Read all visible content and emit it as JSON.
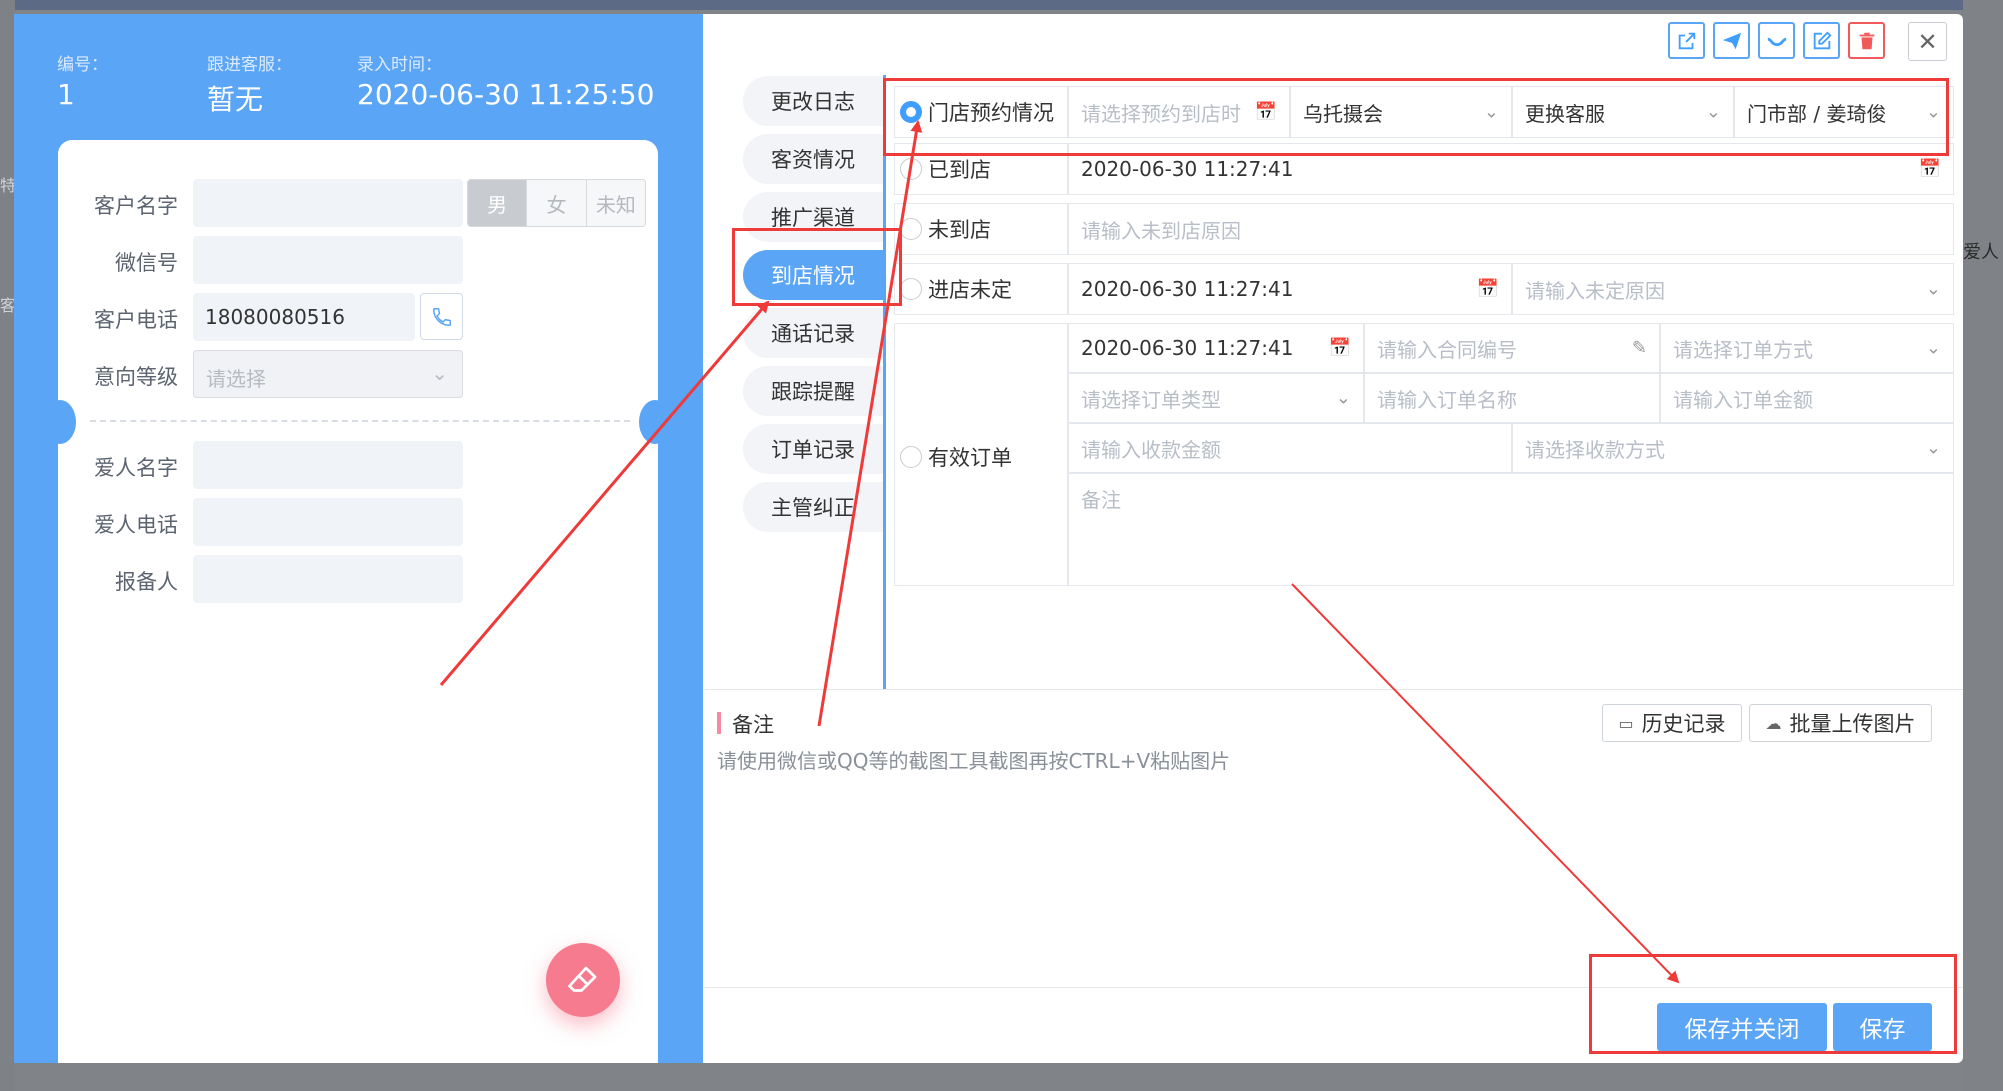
{
  "header": {
    "id_label": "编号：",
    "id_value": "1",
    "service_label": "跟进客服：",
    "service_value": "暂无",
    "time_label": "录入时间：",
    "time_value": "2020-06-30 11:25:50"
  },
  "customer": {
    "name_label": "客户名字",
    "gender_options": [
      "男",
      "女",
      "未知"
    ],
    "wechat_label": "微信号",
    "phone_label": "客户电话",
    "phone_value": "18080080516",
    "level_label": "意向等级",
    "level_placeholder": "请选择",
    "partner_name_label": "爱人名字",
    "partner_phone_label": "爱人电话",
    "reporter_label": "报备人"
  },
  "tabs": [
    "更改日志",
    "客资情况",
    "推广渠道",
    "到店情况",
    "通话记录",
    "跟踪提醒",
    "订单记录",
    "主管纠正"
  ],
  "active_tab": "到店情况",
  "visit": {
    "appointment_label": "门店预约情况",
    "appointment_date_placeholder": "请选择预约到店时",
    "store_value": "乌托摄会",
    "change_service_label": "更换客服",
    "dept_value": "门市部 / 姜琦俊",
    "arrived_label": "已到店",
    "arrived_time": "2020-06-30 11:27:41",
    "not_arrived_label": "未到店",
    "not_arrived_placeholder": "请输入未到店原因",
    "pending_label": "进店未定",
    "pending_time": "2020-06-30 11:27:41",
    "pending_reason_placeholder": "请输入未定原因",
    "valid_order_label": "有效订单",
    "order_time": "2020-06-30 11:27:41",
    "contract_placeholder": "请输入合同编号",
    "order_method_placeholder": "请选择订单方式",
    "order_type_placeholder": "请选择订单类型",
    "order_name_placeholder": "请输入订单名称",
    "order_amount_placeholder": "请输入订单金额",
    "payment_amount_placeholder": "请输入收款金额",
    "payment_method_placeholder": "请选择收款方式",
    "remark_placeholder": "备注"
  },
  "remark": {
    "title": "备注",
    "hint": "请使用微信或QQ等的截图工具截图再按CTRL+V粘贴图片",
    "history_button": "历史记录",
    "upload_button": "批量上传图片"
  },
  "footer": {
    "save_close_button": "保存并关闭",
    "save_button": "保存"
  },
  "background": {
    "left_edge_text_1": "特",
    "left_edge_text_2": "客",
    "right_edge_text": "爱人"
  },
  "colors": {
    "primary": "#5aa5f5",
    "radio_active": "#409eff",
    "annotation_red": "#ef3a3a",
    "fab": "#f77b8e"
  }
}
